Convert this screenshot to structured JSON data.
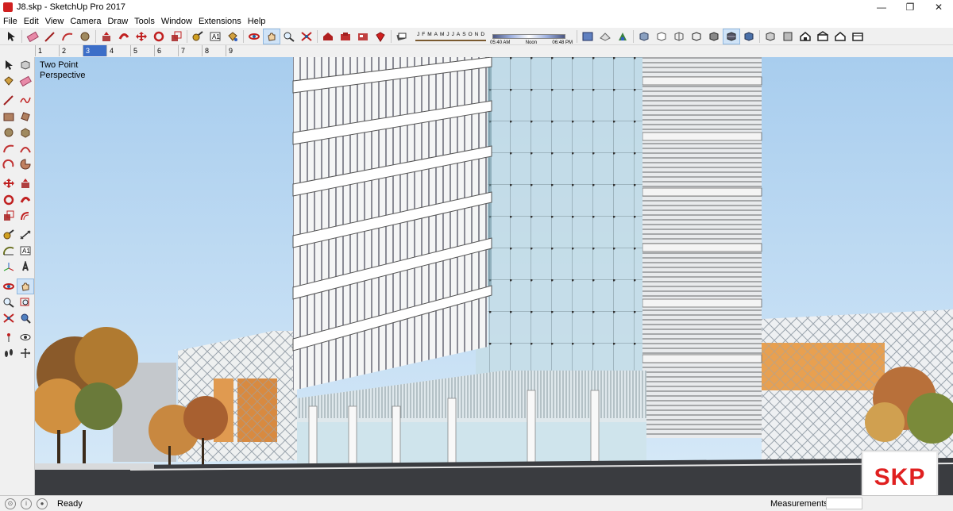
{
  "window": {
    "title": "J8.skp - SketchUp Pro 2017",
    "controls": [
      "—",
      "❐",
      "✕"
    ]
  },
  "menu": [
    "File",
    "Edit",
    "View",
    "Camera",
    "Draw",
    "Tools",
    "Window",
    "Extensions",
    "Help"
  ],
  "shadow_settings": {
    "months": [
      "J",
      "F",
      "M",
      "A",
      "M",
      "J",
      "J",
      "A",
      "S",
      "O",
      "N",
      "D"
    ],
    "time_start": "05:40 AM",
    "time_mid": "Noon",
    "time_end": "06:48 PM"
  },
  "scene_tabs": {
    "items": [
      "1",
      "2",
      "3",
      "4",
      "5",
      "6",
      "7",
      "8",
      "9"
    ],
    "active": "3"
  },
  "viewport": {
    "camera_line1": "Two Point",
    "camera_line2": "Perspective"
  },
  "watermark": {
    "text": "SKP"
  },
  "status": {
    "text": "Ready",
    "measurements_label": "Measurements",
    "measurements_value": ""
  },
  "colors": {
    "accent": "#3c6ec8",
    "sky": "#b8d8f0",
    "watermark": "#e02020"
  },
  "toolbar_icons": [
    "select-icon",
    "eraser-icon",
    "line-icon",
    "arc-icon",
    "shape-icon",
    "push-pull-icon",
    "follow-me-icon",
    "move-icon",
    "rotate-icon",
    "scale-icon",
    "tape-measure-icon",
    "text-icon",
    "paint-bucket-icon",
    "orbit-icon",
    "pan-icon",
    "zoom-icon",
    "zoom-extents-icon",
    "warehouse-icon",
    "extension-warehouse-icon",
    "layout-icon",
    "ruby-icon",
    "shadow-toggle-icon"
  ],
  "style_icons": [
    "xray-icon",
    "back-edges-icon",
    "wireframe-icon",
    "hidden-line-icon",
    "shaded-icon",
    "shaded-textures-icon",
    "monochrome-icon",
    "iso-icon",
    "top-view-icon",
    "front-view-icon",
    "right-view-icon",
    "back-view-icon",
    "left-view-icon"
  ]
}
